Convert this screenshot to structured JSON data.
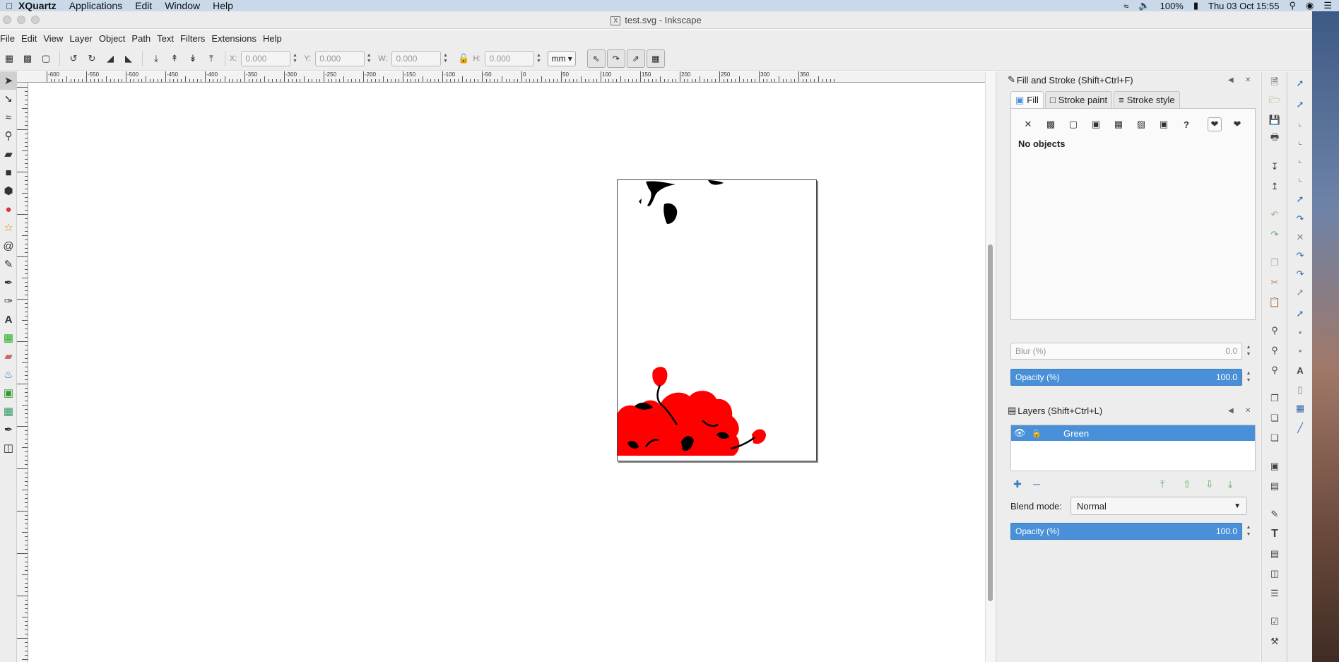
{
  "macos": {
    "app": "XQuartz",
    "menus": [
      "Applications",
      "Edit",
      "Window",
      "Help"
    ],
    "battery": "100%",
    "clock": "Thu 03 Oct  15:55"
  },
  "window": {
    "title": "test.svg - Inkscape",
    "title_icon": "X"
  },
  "menu": [
    "File",
    "Edit",
    "View",
    "Layer",
    "Object",
    "Path",
    "Text",
    "Filters",
    "Extensions",
    "Help"
  ],
  "toolbar": {
    "x_label": "X:",
    "x_value": "0.000",
    "y_label": "Y:",
    "y_value": "0.000",
    "w_label": "W:",
    "w_value": "0.000",
    "h_label": "H:",
    "h_value": "0.000",
    "unit": "mm"
  },
  "ruler": {
    "h_labels": [
      "-600",
      "-550",
      "-500",
      "-450",
      "-400",
      "-350",
      "-300",
      "-250",
      "-200",
      "-150",
      "-100",
      "-50",
      "0",
      "50",
      "100",
      "150",
      "200",
      "250",
      "300",
      "350"
    ]
  },
  "fill_stroke": {
    "title": "Fill and Stroke (Shift+Ctrl+F)",
    "tabs": [
      "Fill",
      "Stroke paint",
      "Stroke style"
    ],
    "no_objects": "No objects",
    "blur_label": "Blur (%)",
    "blur_value": "0.0",
    "opacity_label": "Opacity (%)",
    "opacity_value": "100.0"
  },
  "layers": {
    "title": "Layers (Shift+Ctrl+L)",
    "layer_name": "Green",
    "blend_label": "Blend mode:",
    "blend_value": "Normal",
    "opacity_label": "Opacity (%)",
    "opacity_value": "100.0"
  },
  "colors": {
    "accent": "#4a90d9",
    "flowers": "#ff0000",
    "stems": "#000000"
  }
}
